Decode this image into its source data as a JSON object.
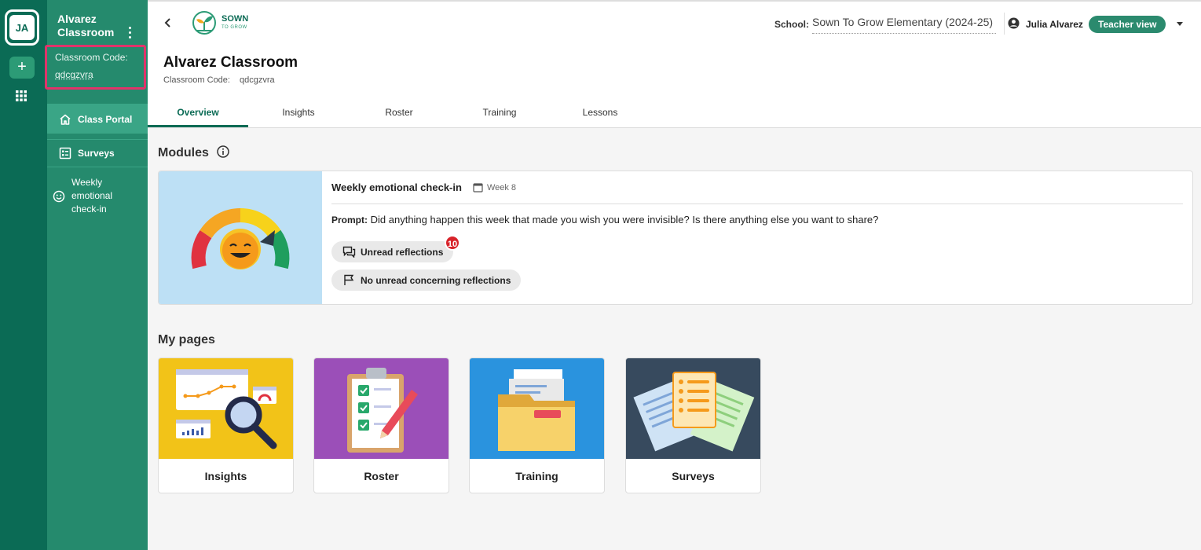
{
  "rail": {
    "avatar_initials": "JA",
    "add_label": "+"
  },
  "sidebar": {
    "class_title": "Alvarez Classroom",
    "code_label": "Classroom Code:",
    "code_value": "qdcgzvra",
    "items": [
      {
        "label": "Class Portal",
        "icon": "home-icon",
        "active": true
      },
      {
        "label": "Surveys",
        "icon": "survey-icon",
        "active": false
      },
      {
        "label": "Weekly emotional check-in",
        "icon": "smiley-icon",
        "active": false
      }
    ]
  },
  "topbar": {
    "logo_text": "SOWN",
    "logo_subtext": "TO GROW",
    "school_label": "School:",
    "school_value": "Sown To Grow Elementary (2024-25)",
    "user_name": "Julia Alvarez",
    "view_badge": "Teacher view"
  },
  "header": {
    "title": "Alvarez Classroom",
    "code_label": "Classroom Code:",
    "code_value": "qdcgzvra",
    "tabs": [
      "Overview",
      "Insights",
      "Roster",
      "Training",
      "Lessons"
    ],
    "active_tab": "Overview"
  },
  "modules": {
    "section_title": "Modules",
    "card": {
      "title": "Weekly emotional check-in",
      "week": "Week 8",
      "prompt_label": "Prompt:",
      "prompt_text": "Did anything happen this week that made you wish you were invisible? Is there anything else you want to share?",
      "unread_label": "Unread reflections",
      "unread_count": "10",
      "concern_label": "No unread concerning reflections"
    }
  },
  "pages": {
    "section_title": "My pages",
    "items": [
      {
        "label": "Insights",
        "color": "#f2c318"
      },
      {
        "label": "Roster",
        "color": "#9b4fb8"
      },
      {
        "label": "Training",
        "color": "#2a93de"
      },
      {
        "label": "Surveys",
        "color": "#374a5e"
      }
    ]
  },
  "colors": {
    "rail": "#0b6b55",
    "sidebar": "#258a6d",
    "accent": "#0b6b55",
    "highlight": "#e0336a",
    "badge_red": "#d8232a"
  }
}
